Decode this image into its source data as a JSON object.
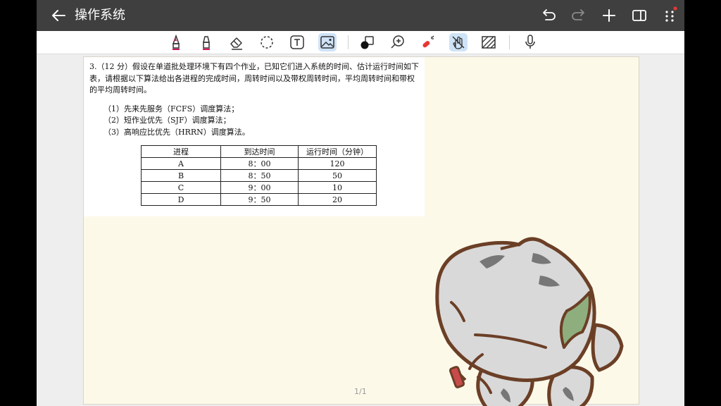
{
  "app": {
    "title": "操作系统",
    "icons": {
      "back": "arrow-left-icon",
      "undo": "undo-icon",
      "redo": "redo-icon",
      "add": "plus-icon",
      "panel": "sidebar-layout-icon",
      "more": "more-icon"
    }
  },
  "toolbar": {
    "tools": [
      "marker-pen-icon",
      "highlighter-icon",
      "eraser-icon",
      "lasso-select-icon",
      "text-box-icon",
      "image-icon",
      "shape-icon",
      "zoom-icon",
      "laser-pointer-icon",
      "hand-tool-icon",
      "pattern-icon",
      "microphone-icon"
    ],
    "active": [
      "image-icon",
      "hand-tool-icon"
    ]
  },
  "document": {
    "question": "3.（12 分）假设在单道批处理环境下有四个作业，已知它们进入系统的时间、估计运行时间如下表，请根据以下算法给出各进程的完成时间，周转时间以及带权周转时间，平均周转时间和带权的平均周转时间。",
    "items": [
      "（1）先来先服务（FCFS）调度算法；",
      "（2）短作业优先（SJF）调度算法；",
      "（3）高响应比优先（HRRN）调度算法。"
    ],
    "table": {
      "headers": [
        "进程",
        "到达时间",
        "运行时间（分钟）"
      ],
      "rows": [
        [
          "A",
          "8：00",
          "120"
        ],
        [
          "B",
          "8：50",
          "50"
        ],
        [
          "C",
          "9：00",
          "10"
        ],
        [
          "D",
          "9：50",
          "20"
        ]
      ]
    }
  },
  "page_indicator": "1/1",
  "colors": {
    "topbar": "#3f3f3f",
    "sheet": "#fdf9e9",
    "active_tool": "#cfe3f7",
    "cat_body": "#d9d9d9",
    "cat_outline": "#6b3f26"
  }
}
